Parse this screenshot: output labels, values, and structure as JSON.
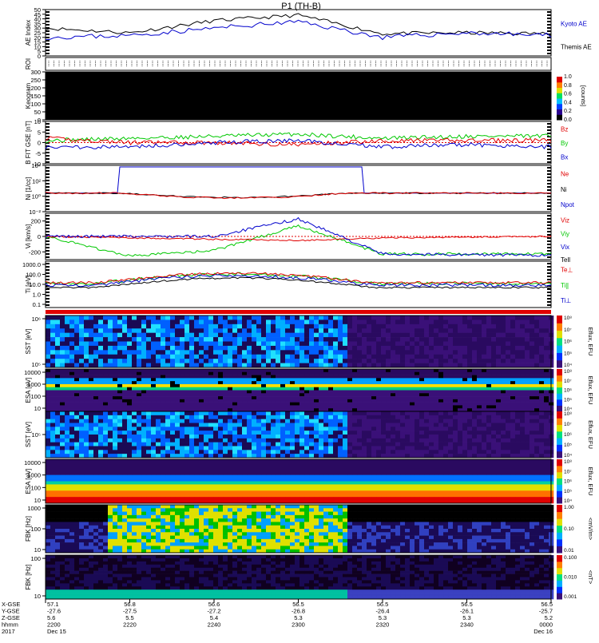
{
  "title": "P1 (TH-B)",
  "colors": {
    "red": "#e00000",
    "green": "#00c800",
    "blue": "#0000cc",
    "black": "#000000"
  },
  "panels": [
    {
      "id": "ae",
      "ylabel": "AE Index",
      "ylim": [
        0,
        50
      ],
      "ticks": [
        "0",
        "5",
        "10",
        "15",
        "20",
        "25",
        "30",
        "35",
        "40",
        "45",
        "50"
      ],
      "legend": [
        {
          "text": "Kyoto AE",
          "color": "#0000cc"
        },
        {
          "text": "Themis AE",
          "color": "#000000"
        }
      ]
    },
    {
      "id": "roi",
      "ylabel": "ROI"
    },
    {
      "id": "keo",
      "ylabel": "Keogram",
      "ticks": [
        "0",
        "50",
        "100",
        "150",
        "200",
        "250",
        "300"
      ],
      "cbar_label": "[counts]",
      "cbar_ticks": [
        "0.0",
        "0.2",
        "0.4",
        "0.6",
        "0.8",
        "1.0"
      ]
    },
    {
      "id": "bfit",
      "ylabel": "B FIT GSE [nT]",
      "ylim": [
        -10,
        10
      ],
      "ticks": [
        "-10",
        "-5",
        "0",
        "5",
        "10"
      ],
      "legend": [
        {
          "text": "Bz",
          "color": "#e00000"
        },
        {
          "text": "By",
          "color": "#00c800"
        },
        {
          "text": "Bx",
          "color": "#0000cc"
        }
      ]
    },
    {
      "id": "ni",
      "ylabel": "Ni [1/cc]",
      "ticks": [
        "10⁻²",
        "10⁰",
        "10²",
        "10⁴"
      ],
      "legend": [
        {
          "text": "Ne",
          "color": "#e00000"
        },
        {
          "text": "Ni",
          "color": "#000000"
        },
        {
          "text": "Npot",
          "color": "#0000cc"
        }
      ]
    },
    {
      "id": "vi",
      "ylabel": "Vi [km/s]",
      "ylim": [
        -300,
        300
      ],
      "ticks": [
        "-200",
        "0",
        "200"
      ],
      "legend": [
        {
          "text": "Viz",
          "color": "#e00000"
        },
        {
          "text": "Viy",
          "color": "#00c800"
        },
        {
          "text": "Vix",
          "color": "#0000cc"
        }
      ]
    },
    {
      "id": "ti",
      "ylabel": "Ti [eV]",
      "ticks": [
        "0.1",
        "1.0",
        "10.0",
        "100.0",
        "1000.0"
      ],
      "legend": [
        {
          "text": "Tell",
          "color": "#000000"
        },
        {
          "text": "Te⊥",
          "color": "#e00000"
        },
        {
          "text": "Ti∥",
          "color": "#00c800"
        },
        {
          "text": "Ti⊥",
          "color": "#0000cc"
        }
      ]
    },
    {
      "id": "sst_e",
      "ylabel": "SST [eV]",
      "ticks": [
        "10⁵",
        "10⁶"
      ],
      "cbar_label": "Eflux, EFU"
    },
    {
      "id": "esa_e",
      "ylabel": "ESA [eV]",
      "ticks": [
        "10",
        "100",
        "1000",
        "10000"
      ],
      "cbar_label": "Eflux, EFU"
    },
    {
      "id": "sst_i",
      "ylabel": "SST [eV]",
      "ticks": [
        "10⁵"
      ],
      "cbar_label": "Eflux, EFU"
    },
    {
      "id": "esa_i",
      "ylabel": "ESA [eV]",
      "ticks": [
        "10",
        "100",
        "1000",
        "10000"
      ],
      "cbar_label": "Eflux, EFU"
    },
    {
      "id": "fbk_e",
      "ylabel": "FBK [Hz]",
      "ticks": [
        "10",
        "100",
        "1000"
      ],
      "cbar_label": "<mV/m>",
      "cbar_ticks": [
        "0.01",
        "0.10",
        "1.00"
      ]
    },
    {
      "id": "fbk_b",
      "ylabel": "FBK [Hz]",
      "ticks": [
        "10",
        "100"
      ],
      "cbar_label": "<nT>",
      "cbar_ticks": [
        "0.001",
        "0.010",
        "0.100"
      ]
    }
  ],
  "spec_cbar_ticks": [
    "10⁴",
    "10⁵",
    "10⁶",
    "10⁷",
    "10⁸"
  ],
  "time_axis": {
    "row_labels": [
      "X-GSE",
      "Y-GSE",
      "Z-GSE",
      "hhmm",
      "2017"
    ],
    "columns": [
      {
        "x": "57.1",
        "y": "-27.6",
        "z": "5.6",
        "hhmm": "2200",
        "date": "Dec 15"
      },
      {
        "x": "56.8",
        "y": "-27.5",
        "z": "5.5",
        "hhmm": "2220",
        "date": ""
      },
      {
        "x": "56.6",
        "y": "-27.2",
        "z": "5.4",
        "hhmm": "2240",
        "date": ""
      },
      {
        "x": "56.5",
        "y": "-26.8",
        "z": "5.3",
        "hhmm": "2300",
        "date": ""
      },
      {
        "x": "56.5",
        "y": "-26.4",
        "z": "5.3",
        "hhmm": "2320",
        "date": ""
      },
      {
        "x": "56.5",
        "y": "-26.1",
        "z": "5.3",
        "hhmm": "2340",
        "date": ""
      },
      {
        "x": "56.5",
        "y": "-25.7",
        "z": "5.2",
        "hhmm": "0000",
        "date": "Dec 16"
      }
    ]
  },
  "chart_data": {
    "type": "line",
    "title": "P1 (TH-B)",
    "x_units": "hhmm, 2017 Dec 15 2200 to Dec 16 0000",
    "series": [
      {
        "name": "Themis AE",
        "panel": "ae",
        "x": [
          "2200",
          "2220",
          "2240",
          "2300",
          "2320",
          "2340",
          "0000"
        ],
        "values": [
          30,
          25,
          38,
          44,
          24,
          25,
          24
        ]
      },
      {
        "name": "Kyoto AE",
        "panel": "ae",
        "x": [
          "2200",
          "2220",
          "2240",
          "2300",
          "2320",
          "2340",
          "0000"
        ],
        "values": [
          20,
          22,
          30,
          37,
          20,
          25,
          22
        ]
      },
      {
        "name": "Bz",
        "panel": "bfit",
        "x": [
          "2200",
          "2220",
          "2240",
          "2300",
          "2320",
          "2340",
          "0000"
        ],
        "values": [
          2,
          0,
          0,
          -1,
          1,
          1,
          1
        ]
      },
      {
        "name": "By",
        "panel": "bfit",
        "x": [
          "2200",
          "2220",
          "2240",
          "2300",
          "2320",
          "2340",
          "0000"
        ],
        "values": [
          1,
          2,
          3,
          4,
          2,
          3,
          3
        ]
      },
      {
        "name": "Bx",
        "panel": "bfit",
        "x": [
          "2200",
          "2220",
          "2240",
          "2300",
          "2320",
          "2340",
          "0000"
        ],
        "values": [
          -2,
          -2,
          0,
          1,
          -2,
          -1,
          -2
        ]
      },
      {
        "name": "Viz",
        "panel": "vi",
        "x": [
          "2200",
          "2220",
          "2240",
          "2300",
          "2320",
          "2340",
          "0000"
        ],
        "values": [
          0,
          -20,
          -40,
          -60,
          -20,
          -10,
          0
        ]
      },
      {
        "name": "Viy",
        "panel": "vi",
        "x": [
          "2200",
          "2220",
          "2240",
          "2300",
          "2320",
          "2340",
          "0000"
        ],
        "values": [
          0,
          -280,
          -200,
          150,
          -250,
          -250,
          -250
        ]
      },
      {
        "name": "Vix",
        "panel": "vi",
        "x": [
          "2200",
          "2220",
          "2240",
          "2300",
          "2320",
          "2340",
          "0000"
        ],
        "values": [
          0,
          0,
          0,
          250,
          -250,
          -260,
          -270
        ]
      }
    ]
  }
}
